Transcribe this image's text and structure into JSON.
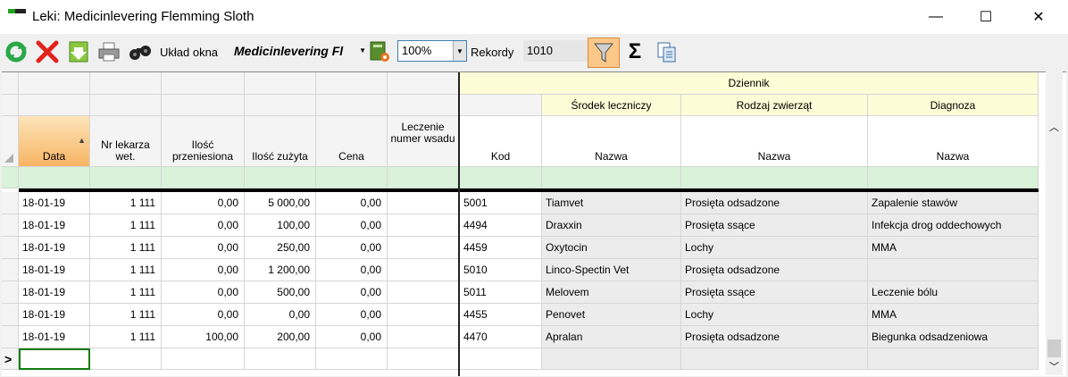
{
  "window": {
    "title": "Leki: Medicinlevering Flemming Sloth",
    "minimize": "—",
    "maximize": "☐",
    "close": "✕"
  },
  "toolbar": {
    "layout_label": "Układ okna",
    "layout_value": "Medicinlevering Fl",
    "zoom_value": "100%",
    "records_label": "Rekordy",
    "records_value": "1010",
    "sum_symbol": "Σ",
    "icons": [
      "refresh-icon",
      "delete-icon",
      "export-icon",
      "print-icon",
      "binoculars-icon",
      "report-icon",
      "filter-icon",
      "sum-icon",
      "copy-icon"
    ]
  },
  "grid": {
    "group_header": "Dziennik",
    "subgroups": {
      "srodek": "Środek leczniczy",
      "rodzaj": "Rodzaj zwierząt",
      "diagnoza": "Diagnoza"
    },
    "columns": {
      "data": "Data",
      "nr": "Nr lekarza wet.",
      "ilosc_p": "Ilość przeniesiona",
      "ilosc_z": "Ilość zużyta",
      "cena": "Cena",
      "leczenie": "Leczenie numer wsadu",
      "kod": "Kod",
      "nazwa1": "Nazwa",
      "nazwa2": "Nazwa",
      "nazwa3": "Nazwa"
    },
    "sort_indicator": "▲",
    "new_row_indicator": ">",
    "rows": [
      [
        "18-01-19",
        "1 111",
        "0,00",
        "5 000,00",
        "0,00",
        "",
        "5001",
        "Tiamvet",
        "Prosięta odsadzone",
        "Zapalenie stawów"
      ],
      [
        "18-01-19",
        "1 111",
        "0,00",
        "100,00",
        "0,00",
        "",
        "4494",
        "Draxxin",
        "Prosięta ssące",
        "Infekcja drog oddechowych"
      ],
      [
        "18-01-19",
        "1 111",
        "0,00",
        "250,00",
        "0,00",
        "",
        "4459",
        "Oxytocin",
        "Lochy",
        "MMA"
      ],
      [
        "18-01-19",
        "1 111",
        "0,00",
        "1 200,00",
        "0,00",
        "",
        "5010",
        "Linco-Spectin Vet",
        "Prosięta odsadzone",
        ""
      ],
      [
        "18-01-19",
        "1 111",
        "0,00",
        "500,00",
        "0,00",
        "",
        "5011",
        "Melovem",
        "Prosięta ssące",
        "Leczenie bólu"
      ],
      [
        "18-01-19",
        "1 111",
        "0,00",
        "0,00",
        "0,00",
        "",
        "4455",
        "Penovet",
        "Lochy",
        "MMA"
      ],
      [
        "18-01-19",
        "1 111",
        "100,00",
        "200,00",
        "0,00",
        "",
        "4470",
        "Apralan",
        "Prosięta odsadzone",
        "Biegunka odsadzeniowa"
      ]
    ]
  }
}
